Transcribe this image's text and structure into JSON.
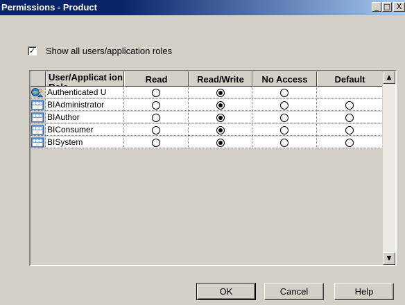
{
  "window": {
    "title": "Permissions - Product",
    "minimize_label": "_",
    "maximize_label": "□",
    "close_label": "X"
  },
  "show_all": {
    "checked": true,
    "check_mark": "✓",
    "label": "Show all users/application roles"
  },
  "grid": {
    "columns": [
      "User/Application Role",
      "Read",
      "Read/Write",
      "No Access",
      "Default"
    ],
    "header_user_label": "User/Applicat ion Role",
    "rows": [
      {
        "name": "Authenticated U",
        "icon": "authenticated-user-icon",
        "selected": "Read/Write",
        "has_default": false
      },
      {
        "name": "BIAdministrator",
        "icon": "application-role-icon",
        "selected": "Read/Write",
        "has_default": true
      },
      {
        "name": "BIAuthor",
        "icon": "application-role-icon",
        "selected": "Read/Write",
        "has_default": true
      },
      {
        "name": "BIConsumer",
        "icon": "application-role-icon",
        "selected": "Read/Write",
        "has_default": true
      },
      {
        "name": "BISystem",
        "icon": "application-role-icon",
        "selected": "Read/Write",
        "has_default": true
      }
    ],
    "scroll_up": "▲",
    "scroll_down": "▼"
  },
  "buttons": {
    "ok": "OK",
    "cancel": "Cancel",
    "help": "Help"
  },
  "colors": {
    "titlebar_start": "#0a246a",
    "titlebar_end": "#a6caf0",
    "dialog_bg": "#d4d0c8"
  }
}
